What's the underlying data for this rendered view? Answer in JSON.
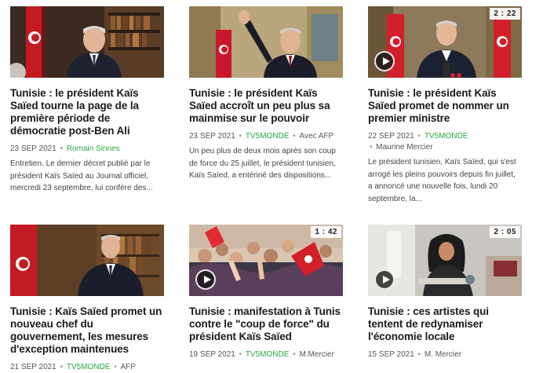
{
  "articles": [
    {
      "title": "Tunisie : le président Kaïs Saïed tourne la page de la première période de démocratie post-Ben Ali",
      "date": "23 SEP 2021",
      "author": "Romain Sinnes",
      "description": "Entretien. Le dernier décret publié par le président Kaïs Saïed au Journal officiel, mercredi 23 septembre, lui confère des..."
    },
    {
      "title": "Tunisie : le président Kaïs Saïed accroît un peu plus sa mainmise sur le pouvoir",
      "date": "23 SEP 2021",
      "source": "TV5MONDE",
      "author": "Avec AFP",
      "description": "Un peu plus de deux mois après son coup de force du 25 juillet, le président tunisien, Kaïs Saïed, a entériné des dispositions..."
    },
    {
      "title": "Tunisie : le président Kaïs Saïed promet de nommer un premier ministre",
      "date": "22 SEP 2021",
      "source": "TV5MONDE",
      "author": "Maurine Mercier",
      "duration": "2 : 22",
      "description": "Le président tunisien, Kaïs Saïed, qui s'est arrogé les pleins pouvoirs depuis fin juillet, a annoncé une nouvelle fois, lundi 20 septembre, la..."
    },
    {
      "title": "Tunisie : Kaïs Saïed promet un nouveau chef du gouvernement, les mesures d'exception maintenues",
      "date": "21 SEP 2021",
      "source": "TV5MONDE",
      "author": "AFP"
    },
    {
      "title": "Tunisie : manifestation à Tunis contre le \"coup de force\" du président Kaïs Saïed",
      "date": "19 SEP 2021",
      "source": "TV5MONDE",
      "author": "M.Mercier",
      "duration": "1 : 42"
    },
    {
      "title": "Tunisie : ces artistes qui tentent de redynamiser l'économie locale",
      "date": "15 SEP 2021",
      "author": "M. Mercier",
      "duration": "2 : 05"
    }
  ],
  "icons": {
    "play": "play-icon"
  },
  "colors": {
    "source": "#2aa644",
    "flag_red": "#d21f2a"
  }
}
